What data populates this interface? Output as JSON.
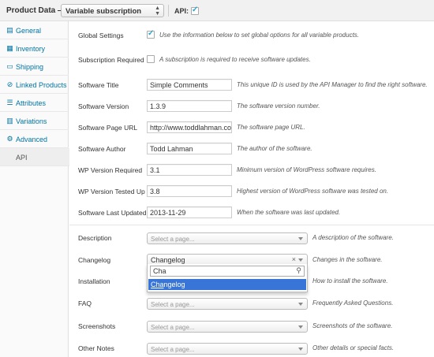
{
  "header": {
    "title": "Product Data —",
    "product_type": "Variable subscription",
    "api_label": "API:"
  },
  "sidebar": {
    "items": [
      {
        "label": "General",
        "icon": "wrench-icon"
      },
      {
        "label": "Inventory",
        "icon": "inventory-icon"
      },
      {
        "label": "Shipping",
        "icon": "truck-icon"
      },
      {
        "label": "Linked Products",
        "icon": "link-icon"
      },
      {
        "label": "Attributes",
        "icon": "list-icon"
      },
      {
        "label": "Variations",
        "icon": "grid-icon"
      },
      {
        "label": "Advanced",
        "icon": "gear-icon"
      },
      {
        "label": "API",
        "icon": ""
      }
    ]
  },
  "fields": {
    "global_settings": {
      "label": "Global Settings",
      "desc": "Use the information below to set global options for all variable products."
    },
    "subscription_required": {
      "label": "Subscription Required",
      "desc": "A subscription is required to receive software updates."
    },
    "software_title": {
      "label": "Software Title",
      "value": "Simple Comments",
      "desc": "This unique ID is used by the API Manager to find the right software."
    },
    "software_version": {
      "label": "Software Version",
      "value": "1.3.9",
      "desc": "The software version number."
    },
    "software_page_url": {
      "label": "Software Page URL",
      "value": "http://www.toddlahman.co",
      "desc": "The software page URL."
    },
    "software_author": {
      "label": "Software Author",
      "value": "Todd Lahman",
      "desc": "The author of the software."
    },
    "wp_version_required": {
      "label": "WP Version Required",
      "value": "3.1",
      "desc": "Minimum version of WordPress software requires."
    },
    "wp_version_tested": {
      "label": "WP Version Tested Up To",
      "value": "3.8",
      "desc": "Highest version of WordPress software was tested on."
    },
    "software_last_updated": {
      "label": "Software Last Updated",
      "value": "2013-11-29",
      "desc": "When the software was last updated."
    }
  },
  "pages": {
    "placeholder": "Select a page...",
    "description": {
      "label": "Description",
      "desc": "A description of the software."
    },
    "changelog": {
      "label": "Changelog",
      "value": "Changelog",
      "desc": "Changes in the software.",
      "search": "Cha",
      "result_match": "Cha",
      "result_rest": "ngelog",
      "clear": "×"
    },
    "installation": {
      "label": "Installation",
      "desc": "How to install the software."
    },
    "faq": {
      "label": "FAQ",
      "desc": "Frequently Asked Questions."
    },
    "screenshots": {
      "label": "Screenshots",
      "desc": "Screenshots of the software."
    },
    "other_notes": {
      "label": "Other Notes",
      "desc": "Other details or special facts."
    }
  },
  "colors": {
    "link": "#0074a2",
    "highlight": "#3875d7",
    "check": "#2ea2cc"
  }
}
